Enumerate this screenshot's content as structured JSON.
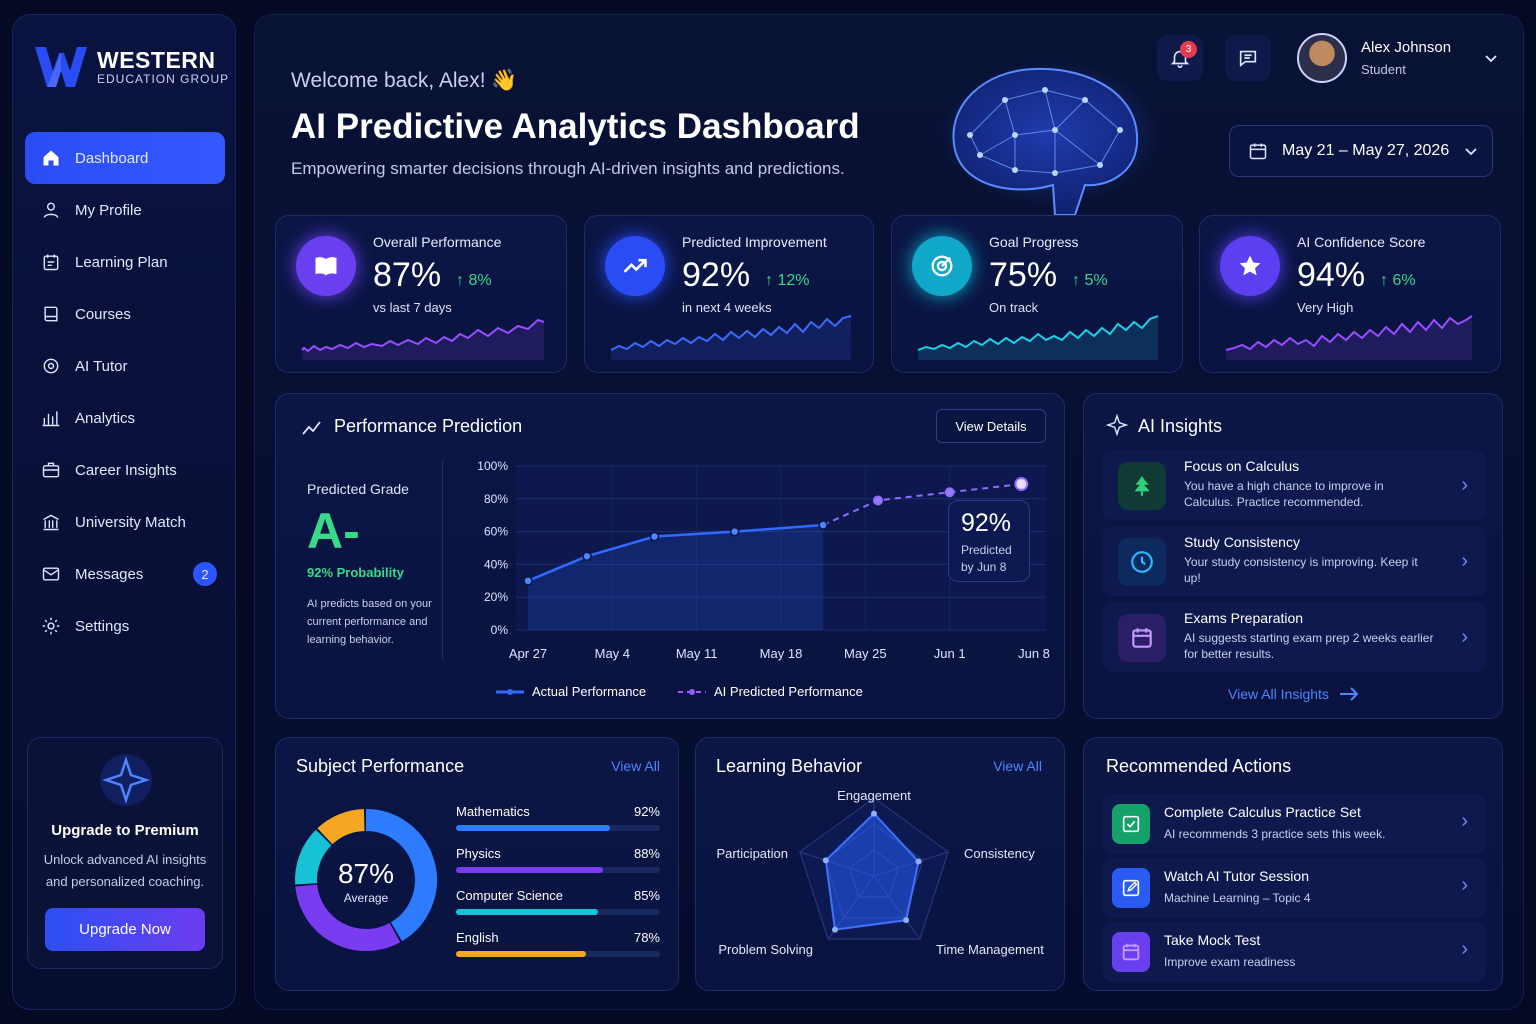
{
  "brand": {
    "name": "WESTERN",
    "sub": "EDUCATION GROUP"
  },
  "nav": [
    {
      "label": "Dashboard",
      "icon": "home-icon",
      "active": true
    },
    {
      "label": "My Profile",
      "icon": "user-icon"
    },
    {
      "label": "Learning Plan",
      "icon": "calendar-plan-icon"
    },
    {
      "label": "Courses",
      "icon": "book-icon"
    },
    {
      "label": "AI Tutor",
      "icon": "ai-tutor-icon"
    },
    {
      "label": "Analytics",
      "icon": "bar-chart-icon"
    },
    {
      "label": "Career Insights",
      "icon": "briefcase-icon"
    },
    {
      "label": "University Match",
      "icon": "university-icon"
    },
    {
      "label": "Messages",
      "icon": "mail-icon",
      "badge": "2"
    },
    {
      "label": "Settings",
      "icon": "gear-icon"
    }
  ],
  "premium": {
    "title": "Upgrade to Premium",
    "desc": "Unlock advanced AI insights and personalized coaching.",
    "button": "Upgrade Now"
  },
  "header": {
    "welcome": "Welcome back, Alex! 👋",
    "title": "AI Predictive Analytics Dashboard",
    "subtitle": "Empowering smarter decisions through AI-driven insights and predictions.",
    "notifications": "3",
    "user_name": "Alex Johnson",
    "user_role": "Student",
    "date_range": "May 21 – May 27, 2026"
  },
  "kpis": [
    {
      "label": "Overall Performance",
      "value": "87%",
      "delta": "8%",
      "sub": "vs last 7 days",
      "color": "#6a3ff0",
      "spark": "#9a4dff"
    },
    {
      "label": "Predicted Improvement",
      "value": "92%",
      "delta": "12%",
      "sub": "in next 4 weeks",
      "color": "#2a4cf5",
      "spark": "#3b6cff"
    },
    {
      "label": "Goal Progress",
      "value": "75%",
      "delta": "5%",
      "sub": "On track",
      "color": "#0fa8c8",
      "spark": "#1fd0e8"
    },
    {
      "label": "AI Confidence Score",
      "value": "94%",
      "delta": "6%",
      "sub": "Very High",
      "color": "#5b3ff0",
      "spark": "#9a4dff"
    }
  ],
  "prediction": {
    "title": "Performance Prediction",
    "button": "View Details",
    "grade_label": "Predicted Grade",
    "grade": "A-",
    "probability": "92% Probability",
    "note": "AI predicts based on your current performance and learning behavior.",
    "callout_value": "92%",
    "callout_text1": "Predicted",
    "callout_text2": "by Jun 8",
    "legend_actual": "Actual Performance",
    "legend_pred": "AI Predicted Performance"
  },
  "chart_data": {
    "type": "line",
    "x": [
      "Apr 27",
      "May 4",
      "May 11",
      "May 18",
      "May 25",
      "Jun 1",
      "Jun 8"
    ],
    "yticks": [
      "0%",
      "20%",
      "40%",
      "60%",
      "80%",
      "100%"
    ],
    "ylim": [
      0,
      100
    ],
    "series": [
      {
        "name": "Actual Performance",
        "points": [
          [
            0,
            30
          ],
          [
            0.7,
            45
          ],
          [
            1.5,
            57
          ],
          [
            2.45,
            60
          ],
          [
            3.5,
            64
          ]
        ]
      },
      {
        "name": "AI Predicted Performance",
        "points": [
          [
            3.5,
            64
          ],
          [
            4.15,
            79
          ],
          [
            5,
            84
          ],
          [
            5.85,
            89
          ]
        ]
      }
    ]
  },
  "insights": {
    "title": "AI Insights",
    "link": "View All Insights",
    "items": [
      {
        "title": "Focus on Calculus",
        "text": "You have a high chance to improve in Calculus. Practice recommended.",
        "icon": "tree-icon"
      },
      {
        "title": "Study Consistency",
        "text": "Your study consistency is improving. Keep it up!",
        "icon": "clock-icon"
      },
      {
        "title": "Exams Preparation",
        "text": "AI suggests starting exam prep 2 weeks earlier for better results.",
        "icon": "calendar-icon"
      }
    ]
  },
  "subjects": {
    "title": "Subject Performance",
    "link": "View All",
    "average": "87%",
    "average_label": "Average",
    "items": [
      {
        "name": "Mathematics",
        "value": "92%",
        "pct": 0.92,
        "color": "#2d7cff"
      },
      {
        "name": "Physics",
        "value": "88%",
        "pct": 0.88,
        "color": "#7a3cf0"
      },
      {
        "name": "Computer Science",
        "value": "85%",
        "pct": 0.85,
        "color": "#18c2d6"
      },
      {
        "name": "English",
        "value": "78%",
        "pct": 0.78,
        "color": "#f5a623"
      }
    ]
  },
  "behavior": {
    "title": "Learning Behavior",
    "link": "View All",
    "axes": [
      "Engagement",
      "Consistency",
      "Time Management",
      "Problem Solving",
      "Participation"
    ],
    "values": [
      0.8,
      0.6,
      0.7,
      0.85,
      0.65
    ]
  },
  "actions": {
    "title": "Recommended Actions",
    "items": [
      {
        "title": "Complete Calculus Practice Set",
        "text": "AI recommends 3 practice sets this week.",
        "icon": "checklist-icon",
        "color": "#16a06a"
      },
      {
        "title": "Watch AI Tutor Session",
        "text": "Machine Learning – Topic 4",
        "icon": "edit-icon",
        "color": "#2a5cf5"
      },
      {
        "title": "Take Mock Test",
        "text": "Improve exam readiness",
        "icon": "calendar-icon",
        "color": "#6a3ff0"
      }
    ]
  }
}
